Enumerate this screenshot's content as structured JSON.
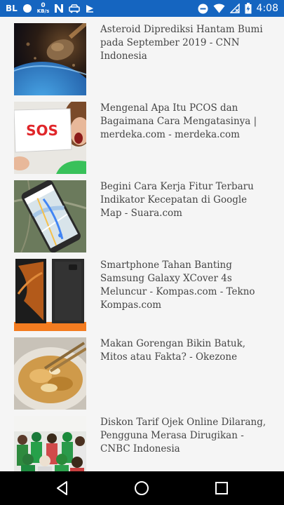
{
  "status_bar": {
    "carrier": "BL",
    "speed_value": "0",
    "speed_unit": "KB/s",
    "time": "4:08"
  },
  "articles": [
    {
      "title": "Asteroid Diprediksi Hantam Bumi pada September 2019 - CNN Indonesia"
    },
    {
      "title": "Mengenal Apa Itu PCOS dan Bagaimana Cara Mengatasinya | merdeka.com - merdeka.com",
      "image_text": "SOS"
    },
    {
      "title": "Begini Cara Kerja Fitur Terbaru Indikator Kecepatan di Google Map - Suara.com"
    },
    {
      "title": "Smartphone Tahan Banting Samsung Galaxy XCover 4s Meluncur - Kompas.com - Tekno Kompas.com"
    },
    {
      "title": "Makan Gorengan Bikin Batuk, Mitos atau Fakta? - Okezone"
    },
    {
      "title": "Diskon Tarif Ojek Online Dilarang, Pengguna Merasa Dirugikan - CNBC Indonesia"
    }
  ],
  "nav_bar": {
    "icons": [
      "back-icon",
      "home-icon",
      "recents-icon"
    ]
  }
}
